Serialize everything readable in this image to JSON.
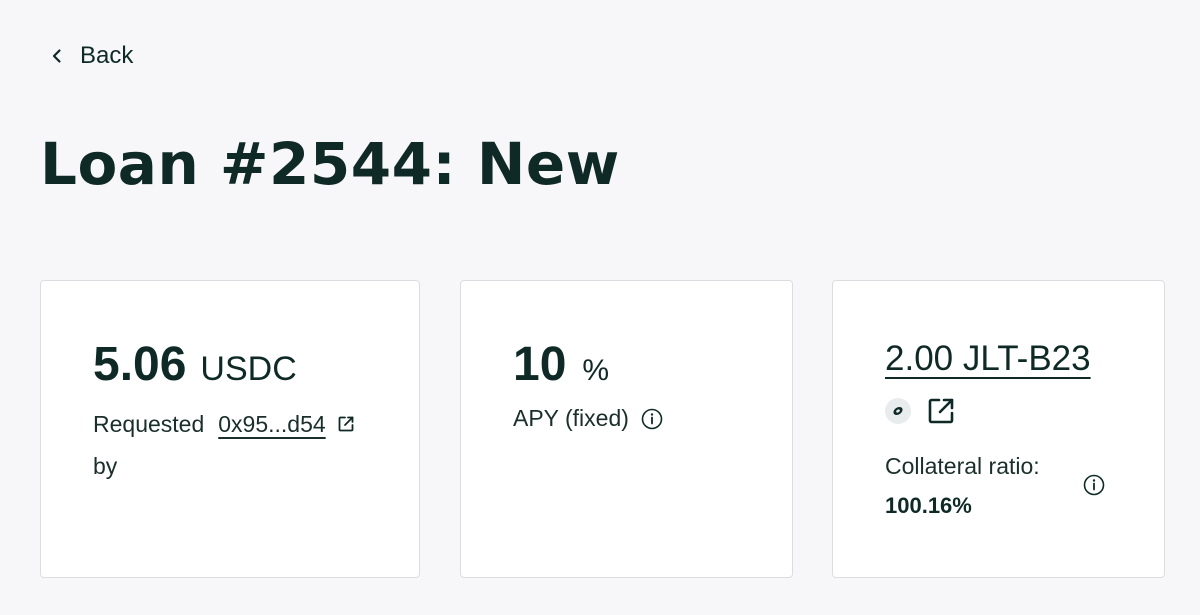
{
  "nav": {
    "back_label": "Back"
  },
  "page": {
    "title": "Loan #2544: New"
  },
  "cards": {
    "principal": {
      "amount": "5.06",
      "unit": "USDC",
      "requested_label": "Requested",
      "requested_by_label": "by",
      "address": "0x95...d54"
    },
    "apy": {
      "value": "10",
      "unit": "%",
      "label": "APY (fixed)"
    },
    "collateral": {
      "amount": "2.00 JLT-B23",
      "ratio_label": "Collateral ratio:",
      "ratio_value": "100.16%"
    }
  },
  "icons": {
    "back": "chevron-left-icon",
    "external_link": "external-link-icon",
    "info": "info-icon",
    "token": "token-icon"
  },
  "colors": {
    "background": "#f7f7f9",
    "text": "#0f2a26",
    "card_border": "#dcdde0"
  }
}
